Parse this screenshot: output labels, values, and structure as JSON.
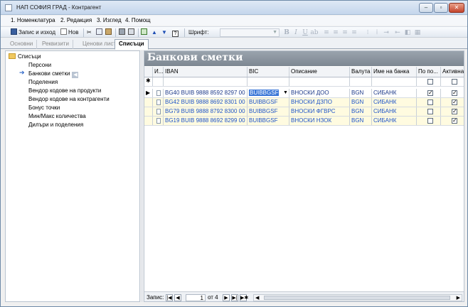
{
  "window": {
    "title": "НАП СОФИЯ ГРАД - Контрагент"
  },
  "menu": [
    {
      "label": "1. Номенклатура"
    },
    {
      "label": "2. Редакция"
    },
    {
      "label": "3. Изглед"
    },
    {
      "label": "4. Помощ"
    }
  ],
  "toolbar": {
    "save_label": "Запис и изход",
    "new_label": "Нов",
    "font_label": "Шрифт:"
  },
  "tabs": [
    {
      "label": "Основни",
      "active": false
    },
    {
      "label": "Реквизити",
      "active": false
    },
    {
      "label": "Ценови листи",
      "active": false
    },
    {
      "label": "Списъци",
      "active": true
    }
  ],
  "tree": {
    "root": "Списъци",
    "items": [
      {
        "label": "Персони"
      },
      {
        "label": "Банкови сметки"
      },
      {
        "label": "Поделения"
      },
      {
        "label": "Вендор кодове на продукти"
      },
      {
        "label": "Вендор кодове на контрагенти"
      },
      {
        "label": "Бонус точки"
      },
      {
        "label": "Мин/Макс количества"
      },
      {
        "label": "Дилъри и поделения"
      }
    ]
  },
  "panel": {
    "title": "Банкови сметки"
  },
  "grid": {
    "columns": [
      "И...",
      "IBAN",
      "BIC",
      "Описание",
      "Валута",
      "Име на банка",
      "По по...",
      "Активна"
    ],
    "new_row_marker": "✱",
    "rows": [
      {
        "iban": "BG40 BUIB 9888 8592 8297 00",
        "bic": "BUIBBGSF",
        "desc": "ВНОСКИ ДОО",
        "currency": "BGN",
        "bank": "СИБАНК",
        "default": true,
        "active": true
      },
      {
        "iban": "BG42 BUIB 9888 8692 8301 00",
        "bic": "BUIBBGSF",
        "desc": "ВНОСКИ ДЗПО",
        "currency": "BGN",
        "bank": "СИБАНК",
        "default": false,
        "active": true
      },
      {
        "iban": "BG79 BUIB 9888 8792 8300 00",
        "bic": "BUIBBGSF",
        "desc": "ВНОСКИ ФГВРС",
        "currency": "BGN",
        "bank": "СИБАНК",
        "default": false,
        "active": true
      },
      {
        "iban": "BG19 BUIB 9888 8692 8299 00",
        "bic": "BUIBBGSF",
        "desc": "ВНОСКИ НЗОК",
        "currency": "BGN",
        "bank": "СИБАНК",
        "default": false,
        "active": true
      }
    ]
  },
  "status": {
    "record_label": "Запис:",
    "current": "1",
    "of_label": "от 4"
  }
}
